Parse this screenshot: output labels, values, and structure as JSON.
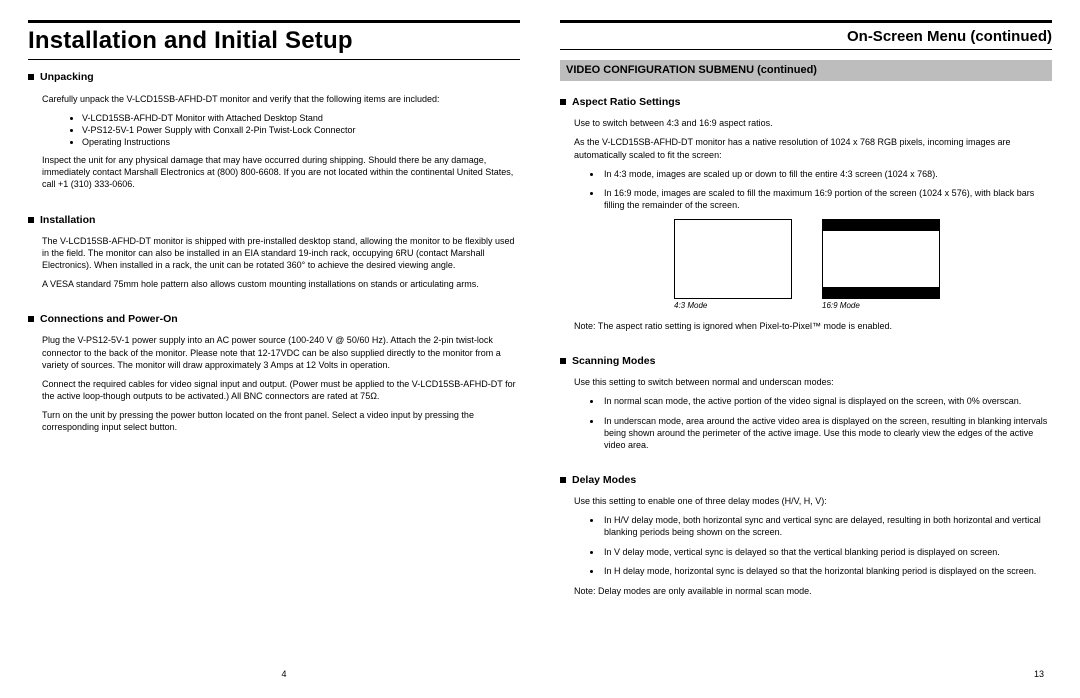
{
  "left": {
    "title": "Installation and Initial Setup",
    "pagenum": "4",
    "unpacking": {
      "heading": "Unpacking",
      "intro": "Carefully unpack the V-LCD15SB-AFHD-DT monitor and verify that the following items are included:",
      "items": [
        "V-LCD15SB-AFHD-DT Monitor with Attached Desktop Stand",
        "V-PS12-5V-1 Power Supply with Conxall 2-Pin Twist-Lock Connector",
        "Operating Instructions"
      ],
      "damage": "Inspect the unit for any physical damage that may have occurred during shipping. Should there be any damage, immediately contact Marshall Electronics at (800) 800-6608. If you are not located within the continental United States, call +1 (310) 333-0606."
    },
    "installation": {
      "heading": "Installation",
      "p1": "The V-LCD15SB-AFHD-DT monitor is shipped with pre-installed desktop stand, allowing the monitor to be flexibly used in the field. The monitor can also be installed in an EIA standard 19-inch rack, occupying 6RU (contact Marshall Electronics). When installed in a rack, the unit can be rotated 360° to achieve the desired viewing angle.",
      "p2": "A VESA standard 75mm hole pattern also allows custom mounting installations on stands or articulating arms."
    },
    "connections": {
      "heading": "Connections and Power-On",
      "p1": "Plug the V-PS12-5V-1 power supply into an AC power source (100-240 V @ 50/60 Hz). Attach the 2-pin twist-lock connector to the back of the monitor. Please note that 12-17VDC can be also supplied directly to the monitor from a variety of sources. The monitor will draw approximately 3 Amps at 12 Volts in operation.",
      "p2": "Connect the required cables for video signal input and output. (Power must be applied to the V-LCD15SB-AFHD-DT for the active loop-though outputs to be activated.) All BNC connectors are rated at 75Ω.",
      "p3": "Turn on the unit by pressing the power button located on the front panel. Select a video input by pressing the corresponding input select button."
    }
  },
  "right": {
    "title": "On-Screen Menu (continued)",
    "subheader": "VIDEO CONFIGURATION SUBMENU (continued)",
    "pagenum": "13",
    "aspect": {
      "heading": "Aspect Ratio Settings",
      "p1": "Use to switch between 4:3 and 16:9 aspect ratios.",
      "p2": "As the V-LCD15SB-AFHD-DT monitor has a native resolution of 1024 x 768 RGB pixels, incoming images are automatically scaled to fit the screen:",
      "b1": "In 4:3 mode, images are scaled up or down to fill the entire 4:3 screen (1024 x 768).",
      "b2": "In 16:9 mode, images are scaled to fill the maximum 16:9 portion of the screen (1024 x 576), with black bars filling the remainder of the screen.",
      "cap1": "4:3 Mode",
      "cap2": "16:9 Mode",
      "note": "Note: The aspect ratio setting is ignored when Pixel-to-Pixel™ mode is enabled."
    },
    "scanning": {
      "heading": "Scanning Modes",
      "p1": "Use this setting to switch between normal and underscan modes:",
      "b1": "In normal scan mode, the active portion of the video signal is displayed on the screen, with 0% overscan.",
      "b2": "In underscan mode, area around the active video area is displayed on the screen, resulting in blanking intervals being shown around the perimeter of the active image. Use this mode to clearly view the edges of the active video area."
    },
    "delay": {
      "heading": "Delay Modes",
      "p1": "Use this setting to enable one of three delay modes (H/V, H, V):",
      "b1": "In H/V delay mode, both horizontal sync and vertical sync are delayed, resulting in both horizontal and vertical blanking periods being shown on the screen.",
      "b2": "In V delay mode, vertical sync is delayed so that the vertical blanking period is displayed on screen.",
      "b3": "In H delay mode, horizontal sync is delayed so that the horizontal blanking period is displayed on the screen.",
      "note": "Note: Delay modes are only available in normal scan mode."
    }
  }
}
